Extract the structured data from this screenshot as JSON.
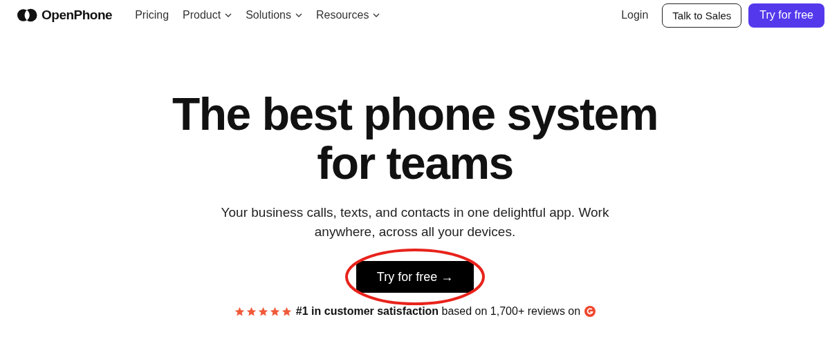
{
  "nav": {
    "brand": "OpenPhone",
    "links": [
      {
        "label": "Pricing",
        "dropdown": false
      },
      {
        "label": "Product",
        "dropdown": true
      },
      {
        "label": "Solutions",
        "dropdown": true
      },
      {
        "label": "Resources",
        "dropdown": true
      }
    ],
    "login": "Login",
    "sales_button": "Talk to Sales",
    "try_button": "Try for free"
  },
  "hero": {
    "title": "The best phone system for teams",
    "subtitle": "Your business calls, texts, and contacts in one delightful app. Work anywhere, across all your devices.",
    "cta": "Try for free →",
    "cta_highlighted": true
  },
  "rating": {
    "stars": 5,
    "text": "**#1 in customer satisfaction** based on 1,700+ reviews on"
  }
}
